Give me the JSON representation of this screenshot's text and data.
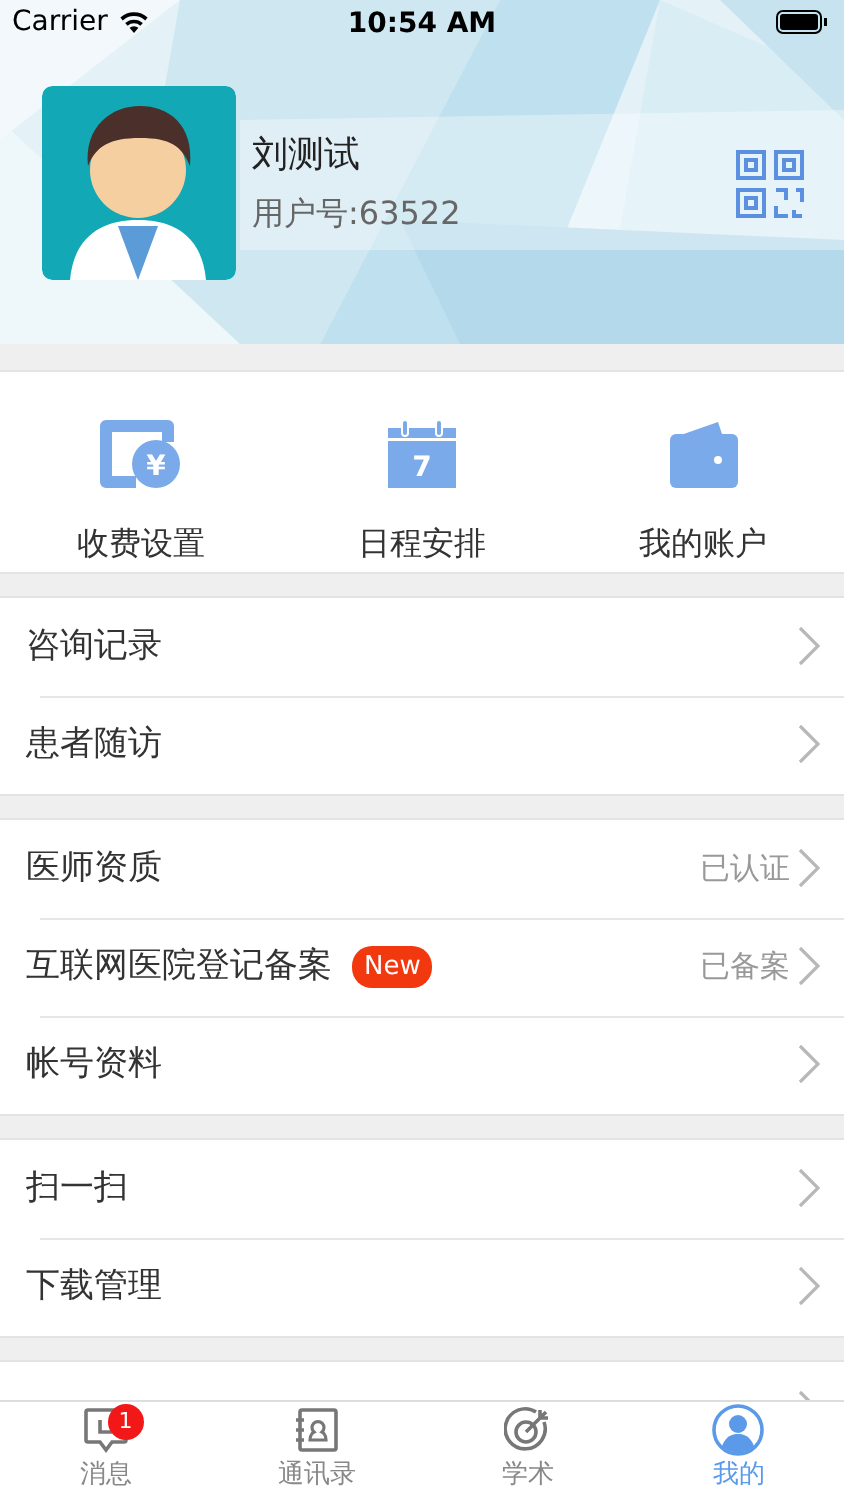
{
  "status_bar": {
    "carrier": "Carrier",
    "time": "10:54 AM"
  },
  "profile": {
    "name": "刘测试",
    "user_id": "用户号:63522"
  },
  "shortcuts": [
    {
      "label": "收费设置",
      "kind": "fee",
      "icon_text": "¥"
    },
    {
      "label": "日程安排",
      "kind": "calendar",
      "icon_text": "7"
    },
    {
      "label": "我的账户",
      "kind": "wallet"
    }
  ],
  "sections": [
    {
      "items": [
        {
          "label": "咨询记录",
          "chevron": true
        },
        {
          "label": "患者随访",
          "chevron": true
        }
      ]
    },
    {
      "items": [
        {
          "label": "医师资质",
          "status": "已认证",
          "chevron": true
        },
        {
          "label": "互联网医院登记备案",
          "badge": "New",
          "status": "已备案",
          "chevron": true
        },
        {
          "label": "帐号资料",
          "chevron": true
        }
      ]
    },
    {
      "items": [
        {
          "label": "扫一扫",
          "chevron": true
        },
        {
          "label": "下载管理",
          "chevron": true
        }
      ]
    },
    {
      "items": [
        {
          "chevron": true
        }
      ]
    }
  ],
  "tabs": [
    {
      "label": "消息",
      "kind": "message",
      "badge": "1",
      "selected": false
    },
    {
      "label": "通讯录",
      "kind": "contacts",
      "selected": false
    },
    {
      "label": "学术",
      "kind": "target",
      "selected": false
    },
    {
      "label": "我的",
      "kind": "profile",
      "selected": true
    }
  ]
}
